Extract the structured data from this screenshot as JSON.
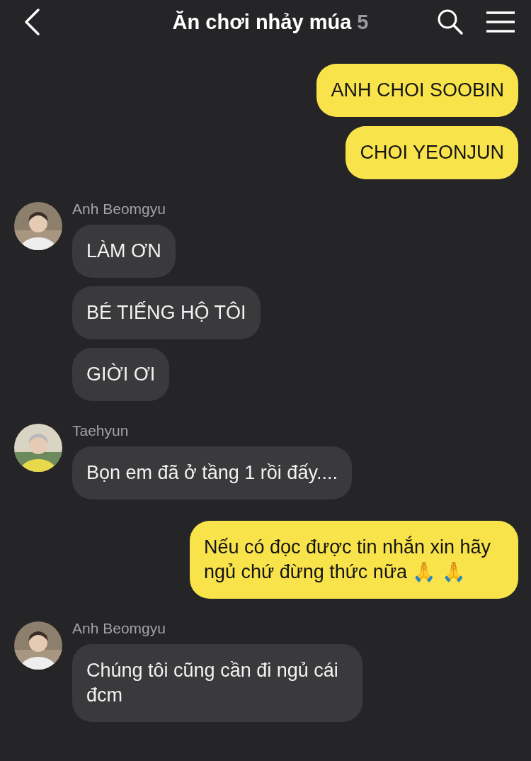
{
  "header": {
    "title": "Ăn chơi nhảy múa",
    "member_count": "5"
  },
  "messages": [
    {
      "kind": "mine",
      "texts": [
        "ANH CHOI SOOBIN",
        "CHOI YEONJUN"
      ]
    },
    {
      "kind": "theirs",
      "sender": "Anh Beomgyu",
      "texts": [
        "LÀM ƠN",
        "BÉ TIẾNG HỘ TÔI",
        "GIỜI ƠI"
      ]
    },
    {
      "kind": "theirs",
      "sender": "Taehyun",
      "texts": [
        "Bọn em đã ở tầng 1 rồi đấy...."
      ]
    },
    {
      "kind": "mine",
      "texts": [
        "Nếu có đọc được tin nhắn xin hãy ngủ chứ đừng thức nữa 🙏 🙏"
      ]
    },
    {
      "kind": "theirs",
      "sender": "Anh Beomgyu",
      "texts": [
        "Chúng tôi cũng cần đi ngủ cái đcm"
      ]
    }
  ]
}
